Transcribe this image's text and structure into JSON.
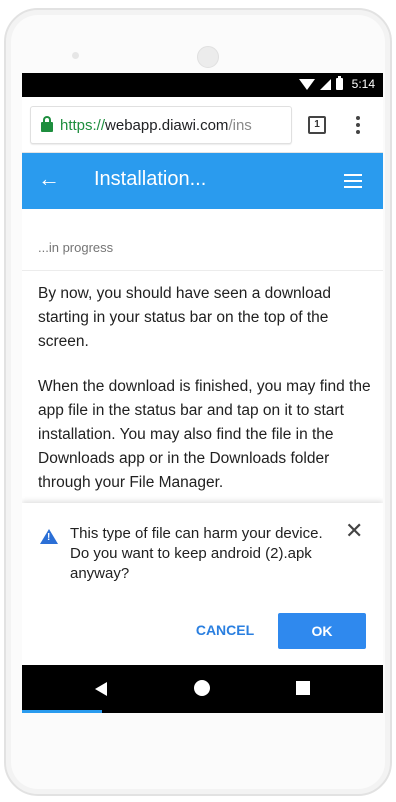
{
  "status_bar": {
    "time": "5:14"
  },
  "browser": {
    "url_scheme": "https://",
    "url_host": "webapp.diawi.com",
    "url_path": "/ins",
    "tab_count": "1"
  },
  "app_bar": {
    "title": "Installation..."
  },
  "page": {
    "progress_label": "...in progress",
    "paragraph_1": "By now, you should have seen a download starting in your status bar on the top of the screen.",
    "paragraph_2": "When the download is finished, you may find the app file in the status bar and tap on it to start installation. You may also find the file in the Downloads app or in the Downloads folder through your File Manager."
  },
  "download_prompt": {
    "message": "This type of file can harm your device. Do you want to keep android (2).apk anyway?",
    "cancel_label": "CANCEL",
    "ok_label": "OK"
  },
  "icons": {
    "close": "✕",
    "back": "←"
  },
  "colors": {
    "app_bar": "#2a9bee",
    "ok_button": "#2f89ee",
    "cancel_text": "#2a7fe0",
    "lock": "#1e8e3e"
  }
}
